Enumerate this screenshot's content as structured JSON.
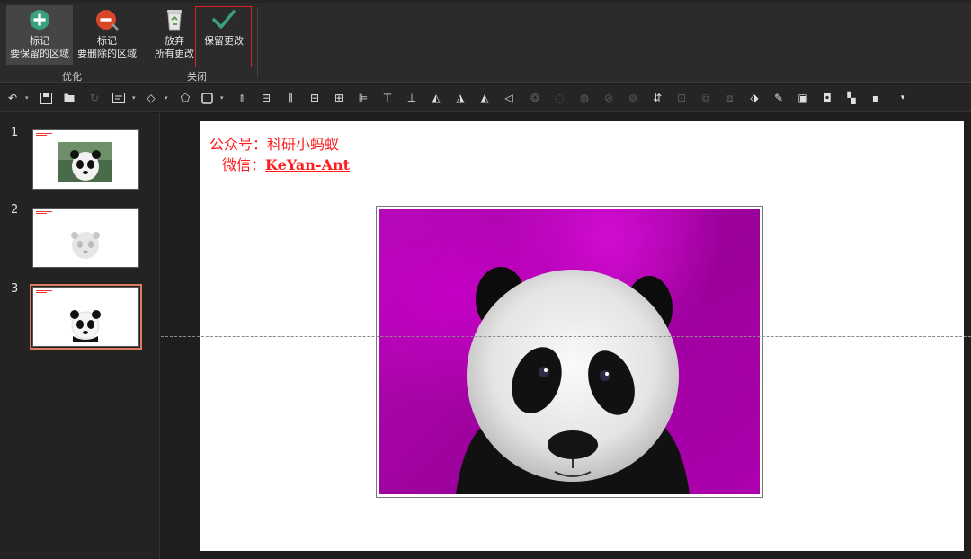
{
  "ribbon": {
    "buttons": [
      {
        "line1": "标记",
        "line2": "要保留的区域",
        "icon": "plus-circle-icon",
        "color": "#3aa17e"
      },
      {
        "line1": "标记",
        "line2": "要删除的区域",
        "icon": "minus-circle-icon",
        "color": "#d9472b"
      },
      {
        "line1": "放弃",
        "line2": "所有更改",
        "icon": "recycle-bin-icon",
        "color": "#6aa84f"
      },
      {
        "line1": "保留更改",
        "line2": "",
        "icon": "checkmark-icon",
        "color": "#3aa17e"
      }
    ],
    "groups": [
      {
        "label": "优化"
      },
      {
        "label": "关闭"
      }
    ]
  },
  "toolbar": {
    "icons": [
      "undo-icon",
      "save-icon",
      "open-icon",
      "redo-icon",
      "textbox-icon",
      "shape-fill-icon",
      "shape-icon",
      "outline-icon",
      "align-left-icon",
      "align-center-icon",
      "align-right-icon",
      "align-top-icon",
      "align-middle-icon",
      "align-bottom-icon",
      "distribute-h-icon",
      "distribute-v-icon",
      "flip-icon",
      "flip-icon-2",
      "flip-icon-3",
      "rotate-icon",
      "group-icon",
      "ungroup-icon",
      "merge-icon",
      "link-icon",
      "combine-icon",
      "text-direction-icon",
      "crop-icon",
      "crop-icon-2",
      "crop-icon-3",
      "format-icon",
      "brush-icon",
      "bring-forward-icon",
      "send-backward-icon",
      "arrange-icon",
      "size-icon",
      "more-icon"
    ]
  },
  "slides": [
    {
      "number": "1"
    },
    {
      "number": "2"
    },
    {
      "number": "3"
    }
  ],
  "slide": {
    "text_line1": "公众号：科研小蚂蚁",
    "text_line2_prefix": "微信：",
    "text_line2_id": "KeYan-Ant",
    "text_color": "#ff1c1c",
    "background_removal_color": "#b000b4"
  }
}
